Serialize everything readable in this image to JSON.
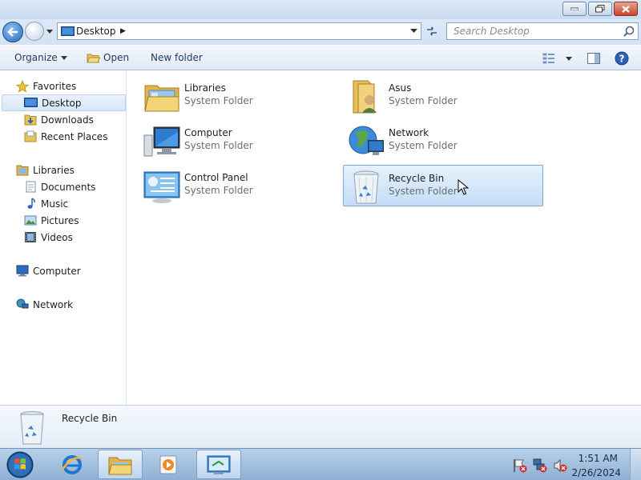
{
  "address": {
    "location": "Desktop",
    "search_placeholder": "Search Desktop"
  },
  "toolbar": {
    "organize": "Organize",
    "open": "Open",
    "new_folder": "New folder"
  },
  "nav": {
    "favorites": "Favorites",
    "desktop": "Desktop",
    "downloads": "Downloads",
    "recent_places": "Recent Places",
    "libraries": "Libraries",
    "documents": "Documents",
    "music": "Music",
    "pictures": "Pictures",
    "videos": "Videos",
    "computer": "Computer",
    "network": "Network"
  },
  "items": [
    {
      "name": "Libraries",
      "type": "System Folder",
      "icon": "libraries-icon"
    },
    {
      "name": "Asus",
      "type": "System Folder",
      "icon": "user-folder-icon"
    },
    {
      "name": "Computer",
      "type": "System Folder",
      "icon": "computer-icon"
    },
    {
      "name": "Network",
      "type": "System Folder",
      "icon": "network-icon"
    },
    {
      "name": "Control Panel",
      "type": "System Folder",
      "icon": "control-panel-icon"
    },
    {
      "name": "Recycle Bin",
      "type": "System Folder",
      "icon": "recycle-bin-icon",
      "selected": true
    }
  ],
  "details": {
    "name": "Recycle Bin"
  },
  "clock": {
    "time": "1:51 AM",
    "date": "2/26/2024"
  },
  "colors": {
    "selection": "#c4ddf6",
    "taskbar": "#a3c2e2"
  }
}
